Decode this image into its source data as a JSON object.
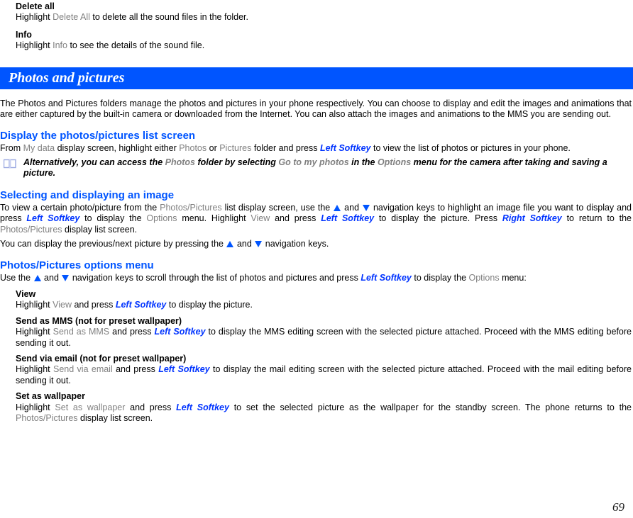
{
  "page": {
    "number": "69",
    "colors": {
      "banner_bg": "#0055ff",
      "heading": "#0055ff",
      "ui_term": "#808080",
      "softkey": "#0033ff",
      "text": "#000000"
    }
  },
  "top_items": [
    {
      "title": "Delete all",
      "body_pre": "Highlight ",
      "body_ui": "Delete All",
      "body_post": " to delete all the sound files in the folder."
    },
    {
      "title": "Info",
      "body_pre": "Highlight ",
      "body_ui": "Info",
      "body_post": " to see the details of the sound file."
    }
  ],
  "banner": {
    "title": "Photos and pictures"
  },
  "intro": "The Photos and Pictures folders manage the photos and pictures in your phone respectively. You can choose to display and edit the images and animations that are either captured by the built-in camera or downloaded from the Internet. You can also attach the images and animations to the MMS you are sending out.",
  "sections": [
    {
      "heading": "Display the photos/pictures list screen",
      "paragraph": {
        "p1": "From ",
        "ui1": "My data",
        "p2": " display screen, highlight either ",
        "ui2": "Photos",
        "p3": " or ",
        "ui3": "Pictures",
        "p4": " folder and press ",
        "sk1": "Left Softkey",
        "p5": " to view the list of photos or pictures in your phone."
      },
      "note": {
        "icon": "open-book-icon",
        "n1": "Alternatively, you can access the ",
        "ui1": "Photos",
        "n2": " folder by selecting ",
        "ui2": "Go to my photos",
        "n3": " in the ",
        "ui3": "Options",
        "n4": " menu for the camera after taking and saving a picture."
      }
    },
    {
      "heading": "Selecting and displaying an image",
      "paragraph": {
        "p1": "To view a certain photo/picture from the ",
        "ui1": "Photos/Pictures",
        "p2": " list display screen, use the ",
        "arrow_up": "▲",
        "p3": " and ",
        "arrow_down": "▼",
        "p4": " navigation keys to highlight an image file you want to display and press ",
        "sk1": "Left Softkey",
        "p5": " to display the ",
        "ui2": "Options",
        "p6": " menu. Highlight ",
        "ui3": "View",
        "p7": " and press ",
        "sk2": "Left Softkey",
        "p8": " to display the picture. Press ",
        "sk3": "Right Softkey",
        "p9": " to return to the ",
        "ui4": "Photos/Pictures",
        "p10": " display list screen."
      },
      "paragraph2": {
        "q1": "You can display the previous/next picture by pressing the ",
        "arrow_up": "▲",
        "q2": " and ",
        "arrow_down": "▼",
        "q3": " navigation keys."
      }
    },
    {
      "heading": "Photos/Pictures options menu",
      "paragraph": {
        "p1": "Use the ",
        "arrow_up": "▲",
        "p2": " and ",
        "arrow_down": "▼",
        "p3": " navigation keys to scroll through the list of photos and pictures and press ",
        "sk1": "Left Softkey",
        "p4": " to display the ",
        "ui1": "Options",
        "p5": " menu:"
      },
      "options": [
        {
          "title": "View",
          "b1": "Highlight ",
          "ui1": "View",
          "b2": " and press ",
          "sk1": "Left Softkey",
          "b3": "  to display the picture."
        },
        {
          "title": "Send as MMS (not for preset wallpaper)",
          "b1": "Highlight ",
          "ui1": "Send as MMS",
          "b2": " and press ",
          "sk1": "Left Softkey",
          "b3": " to display the MMS editing screen with the selected picture attached. Proceed with the MMS editing before sending it out."
        },
        {
          "title": "Send via email (not for preset wallpaper)",
          "b1": "Highlight ",
          "ui1": "Send via email",
          "b2": " and press ",
          "sk1": "Left Softkey",
          "b3": " to display the mail editing screen with the selected picture attached. Proceed with the mail editing before sending it out."
        },
        {
          "title": "Set as wallpaper",
          "b1": "Highlight ",
          "ui1": "Set as wallpaper",
          "b2": " and press ",
          "sk1": "Left Softkey",
          "b3": " to set the selected picture as the wallpaper for the standby screen. The phone returns to the ",
          "ui2": "Photos/Pictures",
          "b4": " display list screen."
        }
      ]
    }
  ]
}
